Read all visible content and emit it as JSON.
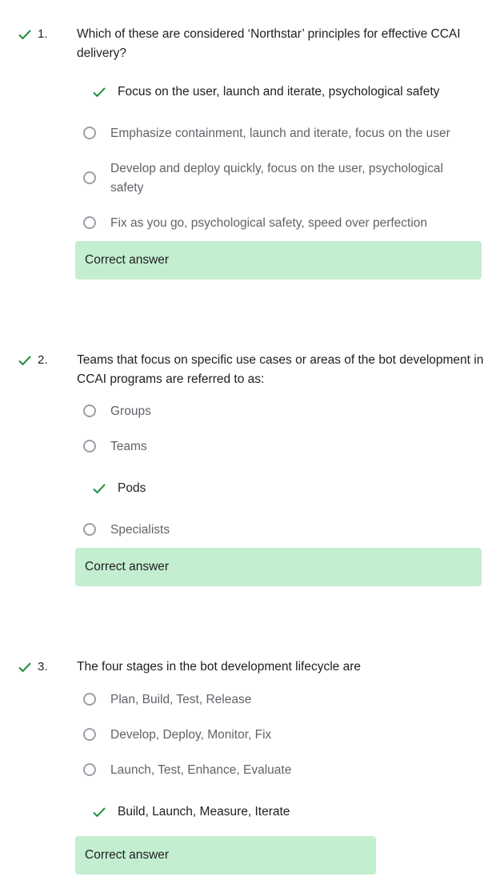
{
  "colors": {
    "check": "#1e8e3e",
    "feedback_bg": "#c4eed0",
    "radio_border": "#9aa0a6",
    "option_text": "#5f6368",
    "selected_text": "#202124"
  },
  "questions": [
    {
      "number": "1.",
      "text": "Which of these are considered ‘Northstar’ principles for effective CCAI delivery?",
      "status_icon": "check-icon",
      "options": [
        {
          "label": "Focus on the user, launch and iterate, psychological safety",
          "selected": true
        },
        {
          "label": "Emphasize containment, launch and iterate, focus on the user",
          "selected": false
        },
        {
          "label": "Develop and deploy quickly, focus on the user, psychological safety",
          "selected": false
        },
        {
          "label": "Fix as you go, psychological safety, speed over perfection",
          "selected": false
        }
      ],
      "feedback": "Correct answer"
    },
    {
      "number": "2.",
      "text": "Teams that focus on specific use cases or areas of the bot development in CCAI programs are referred to as:",
      "status_icon": "check-icon",
      "options": [
        {
          "label": "Groups",
          "selected": false
        },
        {
          "label": "Teams",
          "selected": false
        },
        {
          "label": "Pods",
          "selected": true
        },
        {
          "label": "Specialists",
          "selected": false
        }
      ],
      "feedback": "Correct answer"
    },
    {
      "number": "3.",
      "text": "The four stages in the bot development lifecycle are",
      "status_icon": "check-icon",
      "options": [
        {
          "label": "Plan, Build, Test, Release",
          "selected": false
        },
        {
          "label": "Develop, Deploy, Monitor, Fix",
          "selected": false
        },
        {
          "label": "Launch, Test, Enhance, Evaluate",
          "selected": false
        },
        {
          "label": "Build, Launch, Measure, Iterate",
          "selected": true
        }
      ],
      "feedback": "Correct answer"
    }
  ]
}
